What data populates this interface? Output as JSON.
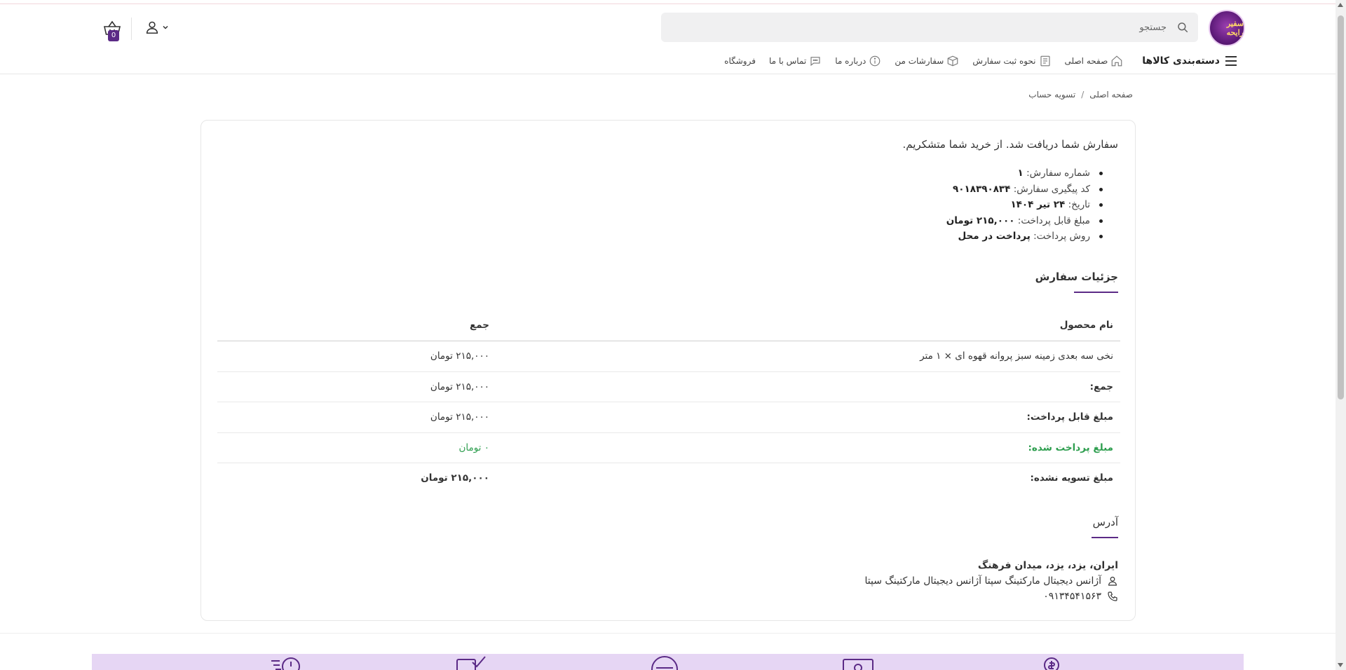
{
  "header": {
    "logo_text": "سفیر رایحه",
    "search": {
      "placeholder": "جستجو"
    },
    "cart_count": "0"
  },
  "nav": {
    "categories": "دسته‌بندی کالاها",
    "items": [
      {
        "label": "صفحه اصلی",
        "icon": "home-icon"
      },
      {
        "label": "نحوه ثبت سفارش",
        "icon": "document-icon"
      },
      {
        "label": "سفارشات من",
        "icon": "box-icon"
      },
      {
        "label": "درباره ما",
        "icon": "info-icon"
      },
      {
        "label": "تماس با ما",
        "icon": "chat-icon"
      },
      {
        "label": "فروشگاه",
        "icon": ""
      }
    ]
  },
  "breadcrumb": {
    "home": "صفحه اصلی",
    "separator": "/",
    "current": "تسویه حساب"
  },
  "order": {
    "thanks": "سفارش شما دریافت شد. از خرید شما متشکریم.",
    "overview": [
      {
        "label": "شماره سفارش:",
        "value": "۱"
      },
      {
        "label": "کد پیگیری سفارش:",
        "value": "۹۰۱۸۳۹۰۸۳۴"
      },
      {
        "label": "تاریخ:",
        "value": "۲۴ تیر ۱۴۰۴"
      },
      {
        "label": "مبلغ قابل پرداخت:",
        "value": "۲۱۵,۰۰۰ تومان"
      },
      {
        "label": "روش پرداخت:",
        "value": "پرداخت در محل"
      }
    ],
    "details_title": "جزئیات سفارش",
    "table": {
      "headers": [
        "نام محصول",
        "جمع"
      ],
      "rows": [
        {
          "label": "نخی سه بعدی زمینه سبز پروانه قهوه ای × ۱ متر",
          "value": "۲۱۵,۰۰۰ تومان"
        },
        {
          "label": "جمع:",
          "value": "۲۱۵,۰۰۰ تومان"
        },
        {
          "label": "مبلغ قابل پرداخت:",
          "value": "۲۱۵,۰۰۰ تومان"
        },
        {
          "label": "مبلغ پرداخت شده:",
          "value": "۰ تومان"
        },
        {
          "label": "مبلغ تسویه نشده:",
          "value": "۲۱۵,۰۰۰ تومان"
        }
      ]
    },
    "address_title": "آدرس",
    "address": {
      "line1": "ایران، یزد، یزد، میدان فرهنگ",
      "name": "آژانس دیجیتال مارکتینگ سپتا آژانس دیجیتال مارکتینگ سپتا",
      "phone": "۰۹۱۳۴۵۴۱۵۶۳"
    }
  },
  "colors": {
    "accent": "#5b2a86",
    "green": "#2e9e4f",
    "features_bg": "#e6d6f4"
  }
}
